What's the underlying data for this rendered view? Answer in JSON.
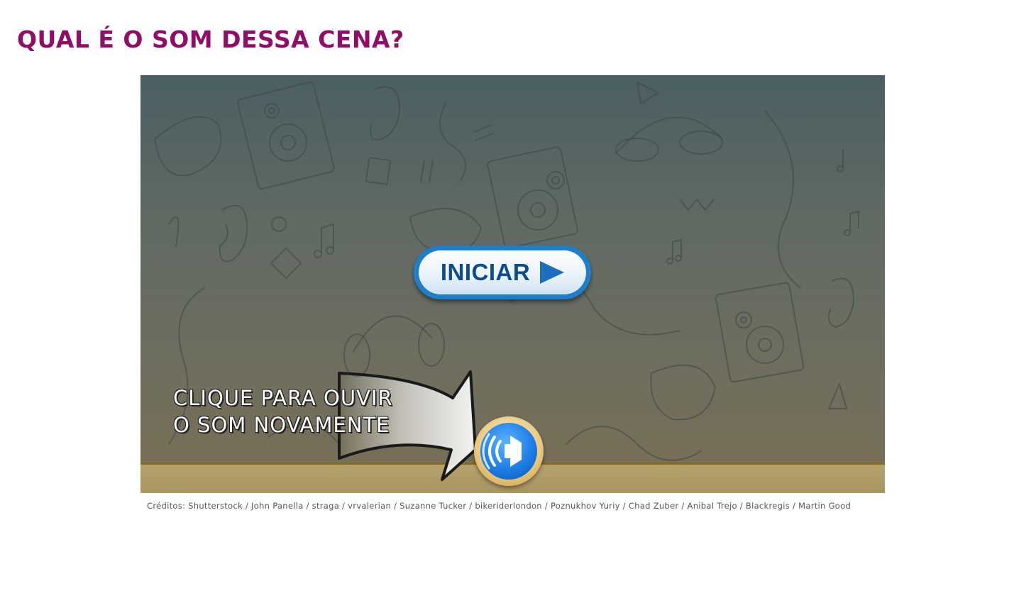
{
  "page": {
    "title": "QUAL É O SOM DESSA CENA?",
    "title_color": "#8f0f66"
  },
  "game": {
    "start_button_label": "INICIAR",
    "start_button_icon": "play-icon",
    "hint_lines": [
      "CLIQUE PARA OUVIR",
      "O SOM NOVAMENTE"
    ],
    "replay_button_icon": "speaker-icon",
    "accent_color": "#1d7fc9",
    "background_theme": "sound-doodles"
  },
  "credits": {
    "text": "Créditos: Shutterstock / John Panella / straga / vrvalerian / Suzanne Tucker / bikeriderlondon / Poznukhov Yuriy / Chad Zuber / Anibal Trejo / Blackregis / Martin Good"
  }
}
